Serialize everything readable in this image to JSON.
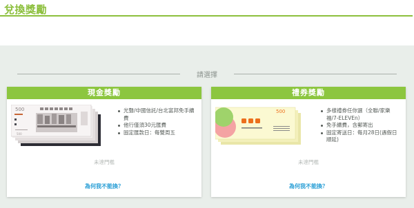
{
  "page": {
    "title": "兌換獎勵"
  },
  "divider": {
    "label": "請選擇"
  },
  "cards": [
    {
      "title": "現金獎勵",
      "note_value": "500",
      "features": [
        "光聲/中國信託/台北富邦免手續費",
        "他行僅須30元匯費",
        "固定匯款日：每雙周五"
      ],
      "status": "未達門檻",
      "link": "為何我不能換？"
    },
    {
      "title": "禮券獎勵",
      "voucher_value": "500",
      "features": [
        "多樣禮券任你選（全聯/家樂福/7-ELEVEn）",
        "免手續費，含郵寄出",
        "固定寄送日：每月28日(遇假日順延)"
      ],
      "status": "未達門檻",
      "link": "為何我不能換？"
    }
  ],
  "colors": {
    "brand_green": "#8cc63f",
    "title_green": "#8cbf3c",
    "link_blue": "#2a9fd6",
    "background": "#e9eeea"
  },
  "icons": {
    "cash": "banknote-stack-illustration",
    "gift": "gift-voucher-stack-illustration"
  }
}
